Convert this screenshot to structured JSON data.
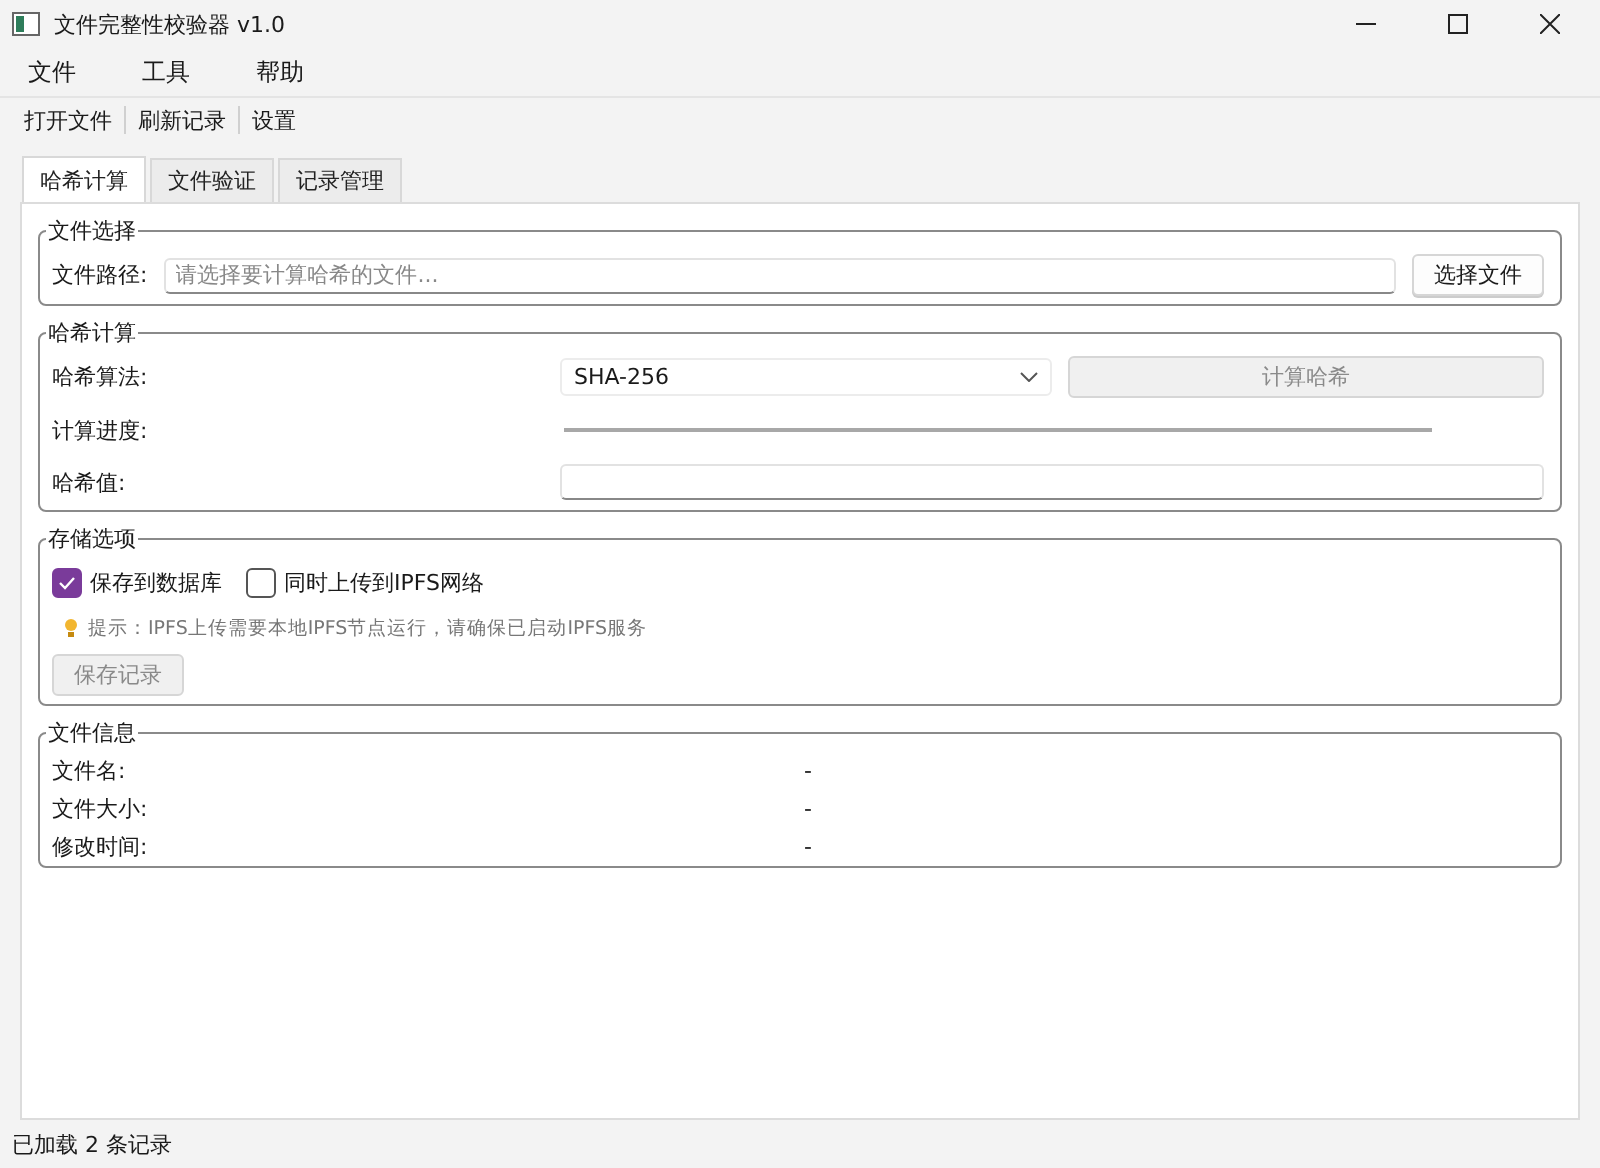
{
  "window": {
    "title": "文件完整性校验器 v1.0"
  },
  "menu": [
    "文件",
    "工具",
    "帮助"
  ],
  "toolbar": [
    "打开文件",
    "刷新记录",
    "设置"
  ],
  "tabs": [
    {
      "label": "哈希计算",
      "selected": true
    },
    {
      "label": "文件验证",
      "selected": false
    },
    {
      "label": "记录管理",
      "selected": false
    }
  ],
  "file_select": {
    "title": "文件选择",
    "label": "文件路径:",
    "placeholder": "请选择要计算哈希的文件...",
    "button": {
      "label": "选择文件",
      "disabled": false
    }
  },
  "hash": {
    "title": "哈希计算",
    "algorithm_label": "哈希算法:",
    "algorithm": "SHA-256",
    "button": {
      "label": "计算哈希",
      "disabled": true
    },
    "progress_label": "计算进度:",
    "progress": {
      "level": 0
    },
    "value_label": "哈希值:"
  },
  "storage": {
    "title": "存储选项",
    "options": [
      {
        "label": "保存到数据库",
        "checked": true
      },
      {
        "label": "同时上传到IPFS网络",
        "checked": false
      }
    ],
    "hint": "提示：IPFS上传需要本地IPFS节点运行，请确保已启动IPFS服务",
    "button": {
      "label": "保存记录",
      "disabled": true
    }
  },
  "info": {
    "title": "文件信息",
    "rows": [
      {
        "label": "文件名:",
        "value": "-"
      },
      {
        "label": "文件大小:",
        "value": "-"
      },
      {
        "label": "修改时间:",
        "value": "-"
      }
    ]
  },
  "status_bar": "已加载 2 条记录"
}
